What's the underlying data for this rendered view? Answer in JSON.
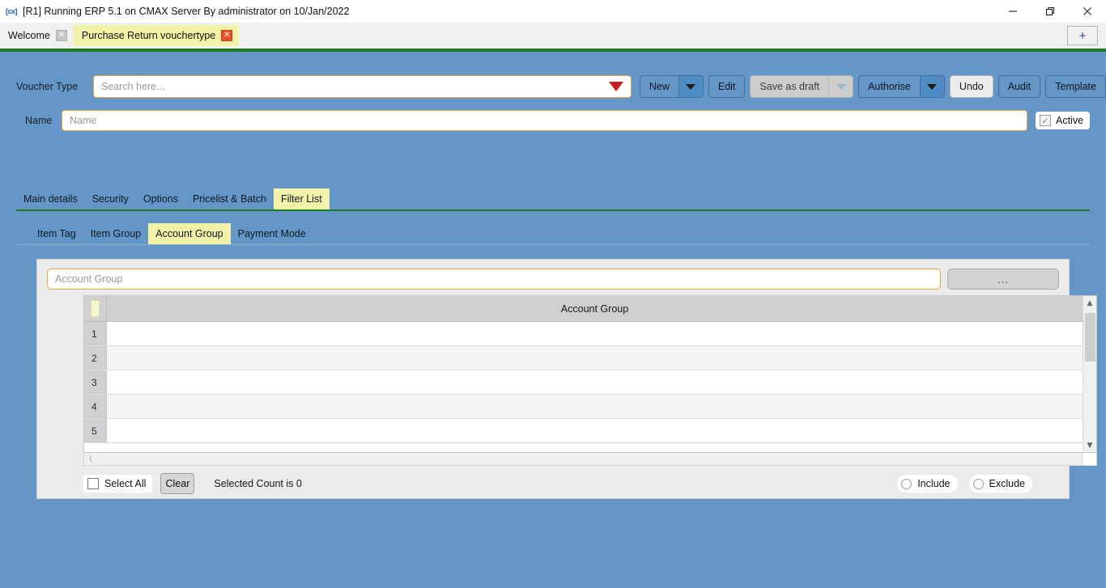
{
  "window": {
    "app_icon": "cx-app-icon",
    "title": "[R1] Running ERP 5.1 on CMAX Server By administrator on 10/Jan/2022",
    "controls": {
      "minimize": "minimize-icon",
      "restore": "restore-icon",
      "close": "close-icon"
    }
  },
  "tabstrip": {
    "tabs": [
      {
        "label": "Welcome",
        "active": false,
        "close": "✕"
      },
      {
        "label": "Purchase Return vouchertype",
        "active": true,
        "close": "✕"
      }
    ],
    "new_tab_label": "+"
  },
  "voucher_type": {
    "label": "Voucher Type",
    "placeholder": "Search here..."
  },
  "toolbar": {
    "new_label": "New",
    "edit_label": "Edit",
    "save_as_draft_label": "Save as draft",
    "authorise_label": "Authorise",
    "undo_label": "Undo",
    "audit_label": "Audit",
    "template_label": "Template"
  },
  "name_row": {
    "label": "Name",
    "placeholder": "Name",
    "active_label": "Active",
    "active_checked": true,
    "check_glyph": "✓"
  },
  "main_tabs": [
    {
      "label": "Main details",
      "active": false
    },
    {
      "label": "Security",
      "active": false
    },
    {
      "label": "Options",
      "active": false
    },
    {
      "label": "Pricelist & Batch",
      "active": false
    },
    {
      "label": "Filter List",
      "active": true
    }
  ],
  "sub_tabs": [
    {
      "label": "Item Tag",
      "active": false
    },
    {
      "label": "Item Group",
      "active": false
    },
    {
      "label": "Account Group",
      "active": true
    },
    {
      "label": "Payment Mode",
      "active": false
    }
  ],
  "filter_panel": {
    "search_placeholder": "Account Group",
    "browse_button_label": "...",
    "grid": {
      "column_header": "Account Group",
      "rows": [
        {
          "number": "1",
          "value": ""
        },
        {
          "number": "2",
          "value": ""
        },
        {
          "number": "3",
          "value": ""
        },
        {
          "number": "4",
          "value": ""
        },
        {
          "number": "5",
          "value": ""
        }
      ]
    },
    "footer": {
      "select_all_label": "Select All",
      "select_all_checked": false,
      "clear_label": "Clear",
      "count_text": "Selected Count is 0",
      "include_label": "Include",
      "exclude_label": "Exclude",
      "include_selected": false,
      "exclude_selected": false
    }
  },
  "colors": {
    "body_blue": "#6496c8",
    "tab_yellow": "#f2f2a8",
    "green_bar": "#1e7a20",
    "input_border_orange": "#e8a33d",
    "dropdown_red": "#c81e1e"
  }
}
